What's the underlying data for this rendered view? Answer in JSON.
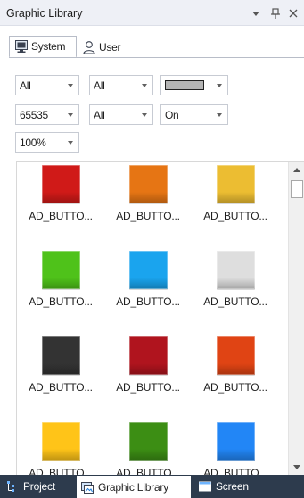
{
  "panel": {
    "title": "Graphic Library",
    "colors": {
      "titlebar": "#eef0f6",
      "bottom_bar": "#2d3b4d"
    }
  },
  "titlebar_buttons": {
    "dropdown_icon": "▾",
    "pin_icon": "ᚫ",
    "close_icon": "✕"
  },
  "tabs": [
    {
      "label": "System",
      "icon": "monitor-icon",
      "active": true
    },
    {
      "label": "User",
      "icon": "user-icon",
      "active": false
    }
  ],
  "filters": {
    "row1": [
      {
        "value": "All"
      },
      {
        "value": "All"
      },
      {
        "value": "",
        "color": "#b4b4b4"
      }
    ],
    "row2": [
      {
        "value": "65535"
      },
      {
        "value": "All"
      },
      {
        "value": "On"
      }
    ],
    "row3": [
      {
        "value": "100%"
      }
    ]
  },
  "items": [
    {
      "label": "AD_BUTTO...",
      "color": "#d01a18"
    },
    {
      "label": "AD_BUTTO...",
      "color": "#e67514"
    },
    {
      "label": "AD_BUTTO...",
      "color": "#ecbd32"
    },
    {
      "label": "AD_BUTTO...",
      "color": "#4fc21a"
    },
    {
      "label": "AD_BUTTO...",
      "color": "#1aa4ee"
    },
    {
      "label": "AD_BUTTO...",
      "color": "#dedede"
    },
    {
      "label": "AD_BUTTO...",
      "color": "#333333"
    },
    {
      "label": "AD_BUTTO...",
      "color": "#b0141e"
    },
    {
      "label": "AD_BUTTO...",
      "color": "#e04414"
    },
    {
      "label": "AD_BUTTO...",
      "color": "#ffc418"
    },
    {
      "label": "AD_BUTTO...",
      "color": "#3c8e14"
    },
    {
      "label": "AD_BUTTO...",
      "color": "#2286f6"
    }
  ],
  "bottom_tabs": [
    {
      "label": "Project",
      "icon": "project-tree-icon",
      "active": false
    },
    {
      "label": "Graphic Library",
      "icon": "graphic-library-icon",
      "active": true
    },
    {
      "label": "Screen",
      "icon": "screen-icon",
      "active": false
    }
  ]
}
